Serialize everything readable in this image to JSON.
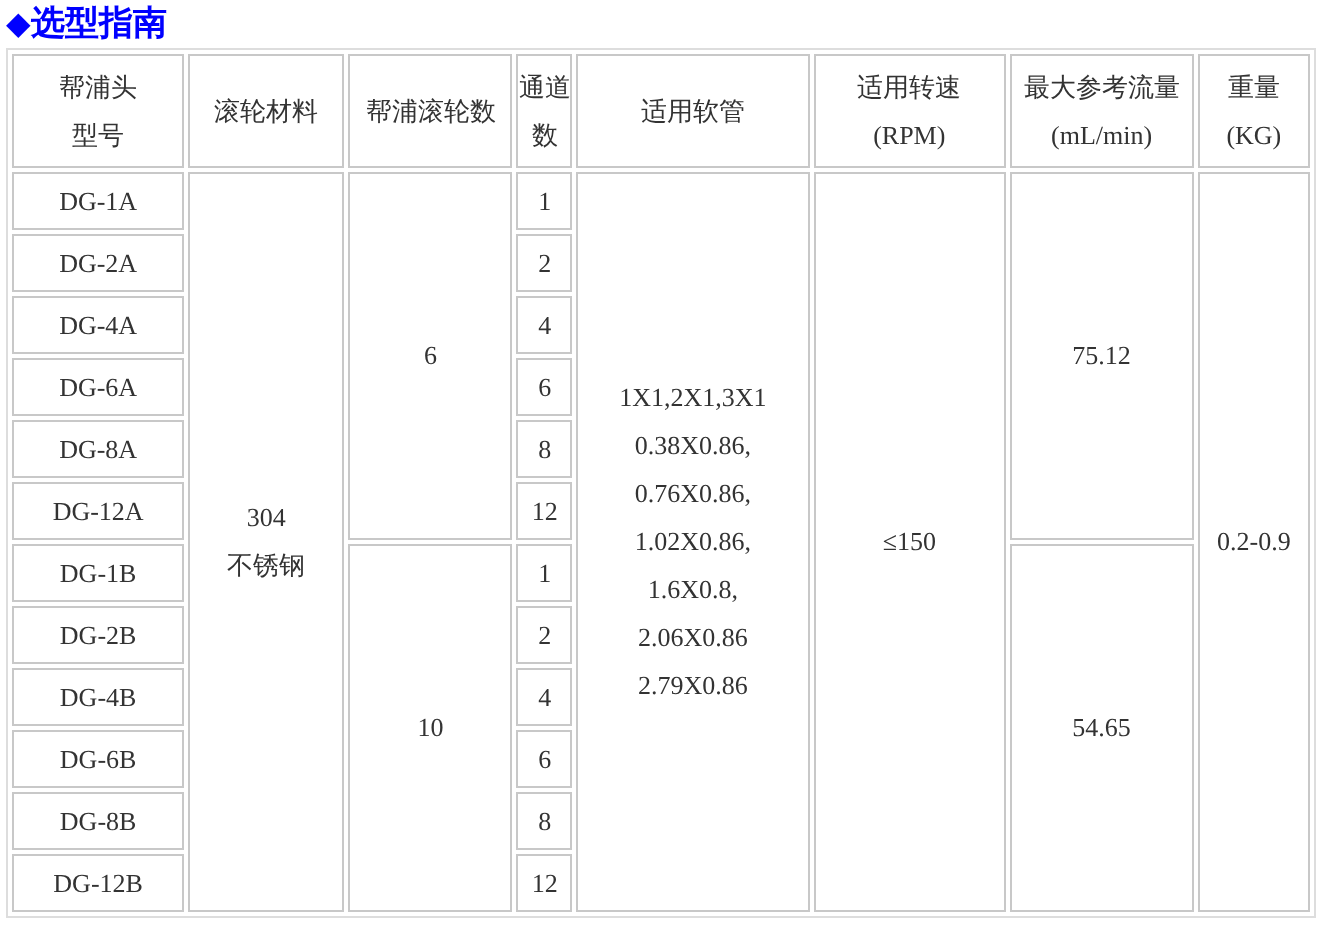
{
  "title": {
    "icon": "◆",
    "text": "选型指南"
  },
  "columns": [
    {
      "lines": [
        "帮浦头",
        "型号"
      ]
    },
    {
      "lines": [
        "滚轮材料"
      ]
    },
    {
      "lines": [
        "帮浦滚轮数"
      ]
    },
    {
      "lines": [
        "通道",
        "数"
      ]
    },
    {
      "lines": [
        "适用软管"
      ]
    },
    {
      "lines": [
        "适用转速",
        "(RPM)"
      ]
    },
    {
      "lines": [
        "最大参考流量",
        "(mL/min)"
      ]
    },
    {
      "lines": [
        "重量",
        "(KG)"
      ]
    }
  ],
  "rows": [
    {
      "model": "DG-1A",
      "channels": "1"
    },
    {
      "model": "DG-2A",
      "channels": "2"
    },
    {
      "model": "DG-4A",
      "channels": "4"
    },
    {
      "model": "DG-6A",
      "channels": "6"
    },
    {
      "model": "DG-8A",
      "channels": "8"
    },
    {
      "model": "DG-12A",
      "channels": "12"
    },
    {
      "model": "DG-1B",
      "channels": "1"
    },
    {
      "model": "DG-2B",
      "channels": "2"
    },
    {
      "model": "DG-4B",
      "channels": "4"
    },
    {
      "model": "DG-6B",
      "channels": "6"
    },
    {
      "model": "DG-8B",
      "channels": "8"
    },
    {
      "model": "DG-12B",
      "channels": "12"
    }
  ],
  "material": [
    "304",
    "不锈钢"
  ],
  "rollers": [
    "6",
    "10"
  ],
  "hoses": [
    "1X1,2X1,3X1",
    "0.38X0.86,",
    "0.76X0.86,",
    "1.02X0.86,",
    "1.6X0.8,",
    "2.06X0.86",
    "2.79X0.86"
  ],
  "rpm": "≤150",
  "flows": [
    "75.12",
    "54.65"
  ],
  "weight": "0.2-0.9"
}
